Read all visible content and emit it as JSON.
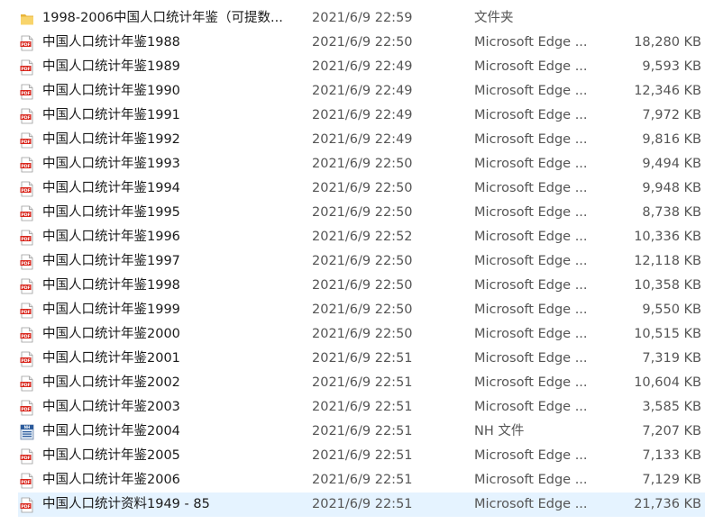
{
  "files": [
    {
      "name": "1998-2006中国人口统计年鉴（可提数...",
      "date": "2021/6/9 22:59",
      "type": "文件夹",
      "size": "",
      "icon": "folder-icon"
    },
    {
      "name": "中国人口统计年鉴1988",
      "date": "2021/6/9 22:50",
      "type": "Microsoft Edge ...",
      "size": "18,280 KB",
      "icon": "pdf-icon"
    },
    {
      "name": "中国人口统计年鉴1989",
      "date": "2021/6/9 22:49",
      "type": "Microsoft Edge ...",
      "size": "9,593 KB",
      "icon": "pdf-icon"
    },
    {
      "name": "中国人口统计年鉴1990",
      "date": "2021/6/9 22:49",
      "type": "Microsoft Edge ...",
      "size": "12,346 KB",
      "icon": "pdf-icon"
    },
    {
      "name": "中国人口统计年鉴1991",
      "date": "2021/6/9 22:49",
      "type": "Microsoft Edge ...",
      "size": "7,972 KB",
      "icon": "pdf-icon"
    },
    {
      "name": "中国人口统计年鉴1992",
      "date": "2021/6/9 22:49",
      "type": "Microsoft Edge ...",
      "size": "9,816 KB",
      "icon": "pdf-icon"
    },
    {
      "name": "中国人口统计年鉴1993",
      "date": "2021/6/9 22:50",
      "type": "Microsoft Edge ...",
      "size": "9,494 KB",
      "icon": "pdf-icon"
    },
    {
      "name": "中国人口统计年鉴1994",
      "date": "2021/6/9 22:50",
      "type": "Microsoft Edge ...",
      "size": "9,948 KB",
      "icon": "pdf-icon"
    },
    {
      "name": "中国人口统计年鉴1995",
      "date": "2021/6/9 22:50",
      "type": "Microsoft Edge ...",
      "size": "8,738 KB",
      "icon": "pdf-icon"
    },
    {
      "name": "中国人口统计年鉴1996",
      "date": "2021/6/9 22:52",
      "type": "Microsoft Edge ...",
      "size": "10,336 KB",
      "icon": "pdf-icon"
    },
    {
      "name": "中国人口统计年鉴1997",
      "date": "2021/6/9 22:50",
      "type": "Microsoft Edge ...",
      "size": "12,118 KB",
      "icon": "pdf-icon"
    },
    {
      "name": "中国人口统计年鉴1998",
      "date": "2021/6/9 22:50",
      "type": "Microsoft Edge ...",
      "size": "10,358 KB",
      "icon": "pdf-icon"
    },
    {
      "name": "中国人口统计年鉴1999",
      "date": "2021/6/9 22:50",
      "type": "Microsoft Edge ...",
      "size": "9,550 KB",
      "icon": "pdf-icon"
    },
    {
      "name": "中国人口统计年鉴2000",
      "date": "2021/6/9 22:50",
      "type": "Microsoft Edge ...",
      "size": "10,515 KB",
      "icon": "pdf-icon"
    },
    {
      "name": "中国人口统计年鉴2001",
      "date": "2021/6/9 22:51",
      "type": "Microsoft Edge ...",
      "size": "7,319 KB",
      "icon": "pdf-icon"
    },
    {
      "name": "中国人口统计年鉴2002",
      "date": "2021/6/9 22:51",
      "type": "Microsoft Edge ...",
      "size": "10,604 KB",
      "icon": "pdf-icon"
    },
    {
      "name": "中国人口统计年鉴2003",
      "date": "2021/6/9 22:51",
      "type": "Microsoft Edge ...",
      "size": "3,585 KB",
      "icon": "pdf-icon"
    },
    {
      "name": "中国人口统计年鉴2004",
      "date": "2021/6/9 22:51",
      "type": "NH 文件",
      "size": "7,207 KB",
      "icon": "nh-file-icon"
    },
    {
      "name": "中国人口统计年鉴2005",
      "date": "2021/6/9 22:51",
      "type": "Microsoft Edge ...",
      "size": "7,133 KB",
      "icon": "pdf-icon"
    },
    {
      "name": "中国人口统计年鉴2006",
      "date": "2021/6/9 22:51",
      "type": "Microsoft Edge ...",
      "size": "7,129 KB",
      "icon": "pdf-icon"
    },
    {
      "name": "中国人口统计资料1949 - 85",
      "date": "2021/6/9 22:51",
      "type": "Microsoft Edge ...",
      "size": "21,736 KB",
      "icon": "pdf-icon",
      "selected": true
    }
  ],
  "colors": {
    "selection": "#e5f3ff",
    "pdf_red": "#d9261c",
    "folder_yellow": "#f5c542",
    "nh_blue": "#2b5b9c"
  }
}
